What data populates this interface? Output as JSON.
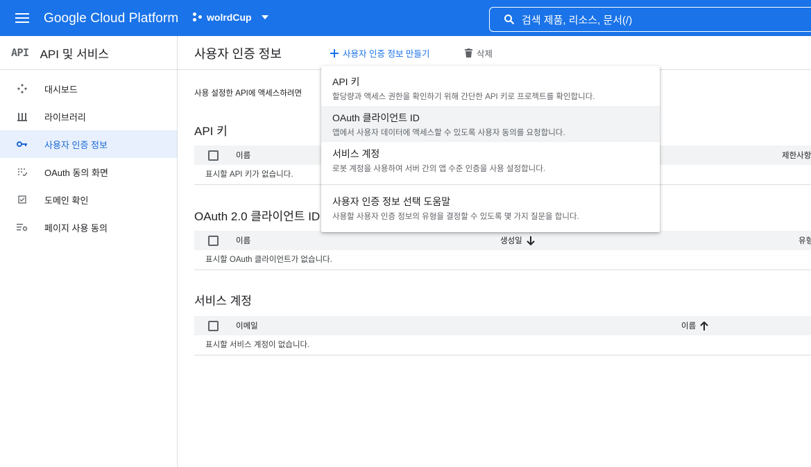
{
  "topbar": {
    "brand": "Google Cloud Platform",
    "project": "wolrdCup",
    "search_placeholder": "검색   제품, 리소스, 문서(/)"
  },
  "sidebar": {
    "logo": "API",
    "title": "API 및 서비스",
    "items": [
      {
        "label": "대시보드",
        "icon": "dashboard-icon"
      },
      {
        "label": "라이브러리",
        "icon": "library-icon"
      },
      {
        "label": "사용자 인증 정보",
        "icon": "key-icon",
        "active": true
      },
      {
        "label": "OAuth 동의 화면",
        "icon": "consent-icon"
      },
      {
        "label": "도메인 확인",
        "icon": "checkbox-icon"
      },
      {
        "label": "페이지 사용 동의",
        "icon": "settings-list-icon"
      }
    ]
  },
  "main": {
    "title": "사용자 인증 정보",
    "create_label": "사용자 인증 정보 만들기",
    "delete_label": "삭제",
    "intro": "사용 설정한 API에 액세스하려면",
    "sections": {
      "api_keys": {
        "title": "API 키",
        "col_name": "이름",
        "col_restrict": "제한사항",
        "empty": "표시할 API 키가 없습니다."
      },
      "oauth": {
        "title": "OAuth 2.0 클라이언트 ID",
        "col_name": "이름",
        "col_created": "생성일",
        "col_type": "유형",
        "empty": "표시할 OAuth 클라이언트가 없습니다."
      },
      "service": {
        "title": "서비스 계정",
        "col_email": "이메일",
        "col_name": "이름",
        "empty": "표시할 서비스 계정이 없습니다."
      }
    }
  },
  "dropdown": {
    "items": [
      {
        "title": "API 키",
        "desc": "할당량과 액세스 권한을 확인하기 위해 간단한 API 키로 프로젝트를 확인합니다."
      },
      {
        "title": "OAuth 클라이언트 ID",
        "desc": "앱에서 사용자 데이터에 액세스할 수 있도록 사용자 동의를 요청합니다."
      },
      {
        "title": "서비스 계정",
        "desc": "로봇 계정을 사용하여 서버 간의 앱 수준 인증을 사용 설정합니다."
      },
      {
        "title": "사용자 인증 정보 선택 도움말",
        "desc": "사용할 사용자 인증 정보의 유형을 결정할 수 있도록 몇 가지 질문을 합니다."
      }
    ]
  },
  "colors": {
    "primary": "#1a73e8",
    "active_bg": "#e8f0fe",
    "header_bg": "#f1f3f4"
  }
}
